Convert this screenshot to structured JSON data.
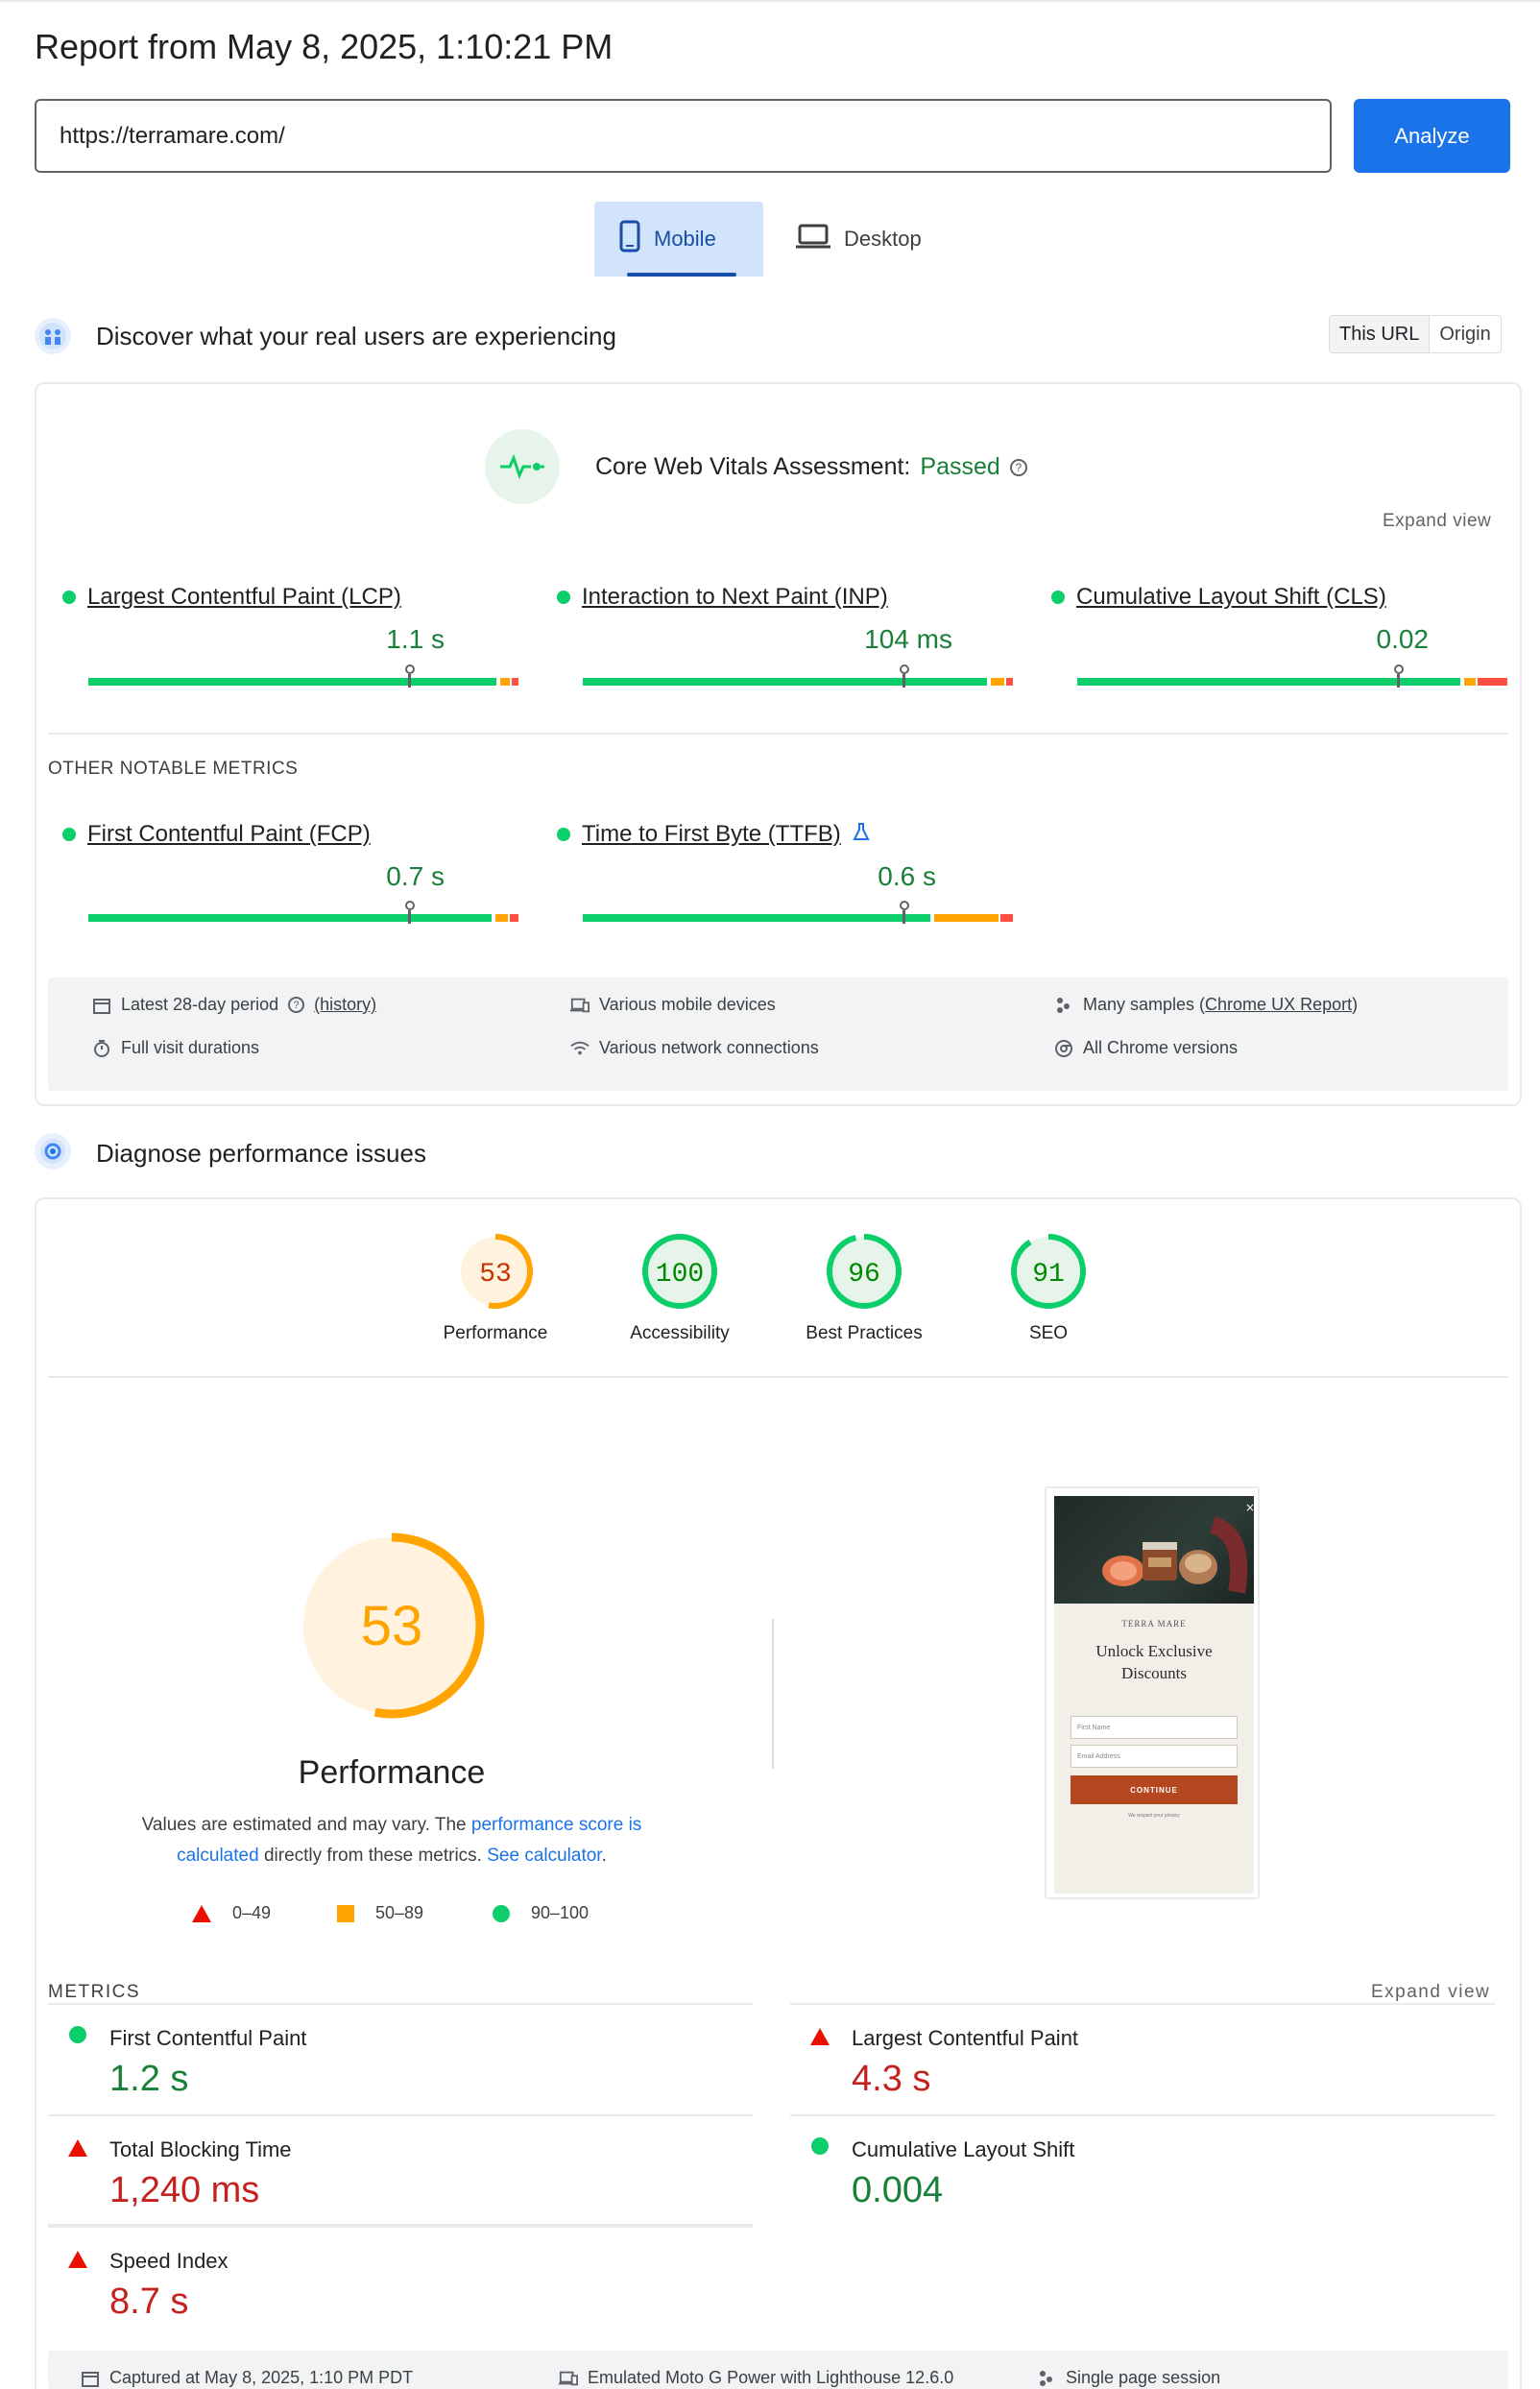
{
  "report": {
    "title": "Report from May 8, 2025, 1:10:21 PM",
    "url_value": "https://terramare.com/",
    "analyze_label": "Analyze"
  },
  "device_tabs": [
    {
      "label": "Mobile",
      "icon": "phone-icon",
      "active": true
    },
    {
      "label": "Desktop",
      "icon": "laptop-icon",
      "active": false
    }
  ],
  "field_section": {
    "title": "Discover what your real users are experiencing",
    "toggle": {
      "this_url": "This URL",
      "origin": "Origin"
    },
    "assessment_prefix": "Core Web Vitals Assessment:",
    "assessment_status": "Passed",
    "expand_label": "Expand view",
    "core_metrics": [
      {
        "name": "Largest Contentful Paint (LCP)",
        "value": "1.1 s",
        "good_fraction": 0.75,
        "marker": 0.75
      },
      {
        "name": "Interaction to Next Paint (INP)",
        "value": "104 ms",
        "good_fraction": 0.75,
        "marker": 0.75
      },
      {
        "name": "Cumulative Layout Shift (CLS)",
        "value": "0.02",
        "good_fraction": 0.75,
        "marker": 0.75
      }
    ],
    "other_label": "OTHER NOTABLE METRICS",
    "other_metrics": [
      {
        "name": "First Contentful Paint (FCP)",
        "value": "0.7 s",
        "marker": 0.75
      },
      {
        "name": "Time to First Byte (TTFB)",
        "value": "0.6 s",
        "marker": 0.75,
        "experimental": true
      }
    ],
    "info": {
      "period": "Latest 28-day period",
      "history": "(history)",
      "devices": "Various mobile devices",
      "samples_prefix": "Many samples (",
      "samples_link": "Chrome UX Report",
      "samples_suffix": ")",
      "durations": "Full visit durations",
      "network": "Various network connections",
      "chrome": "All Chrome versions"
    }
  },
  "diagnose_section": {
    "title": "Diagnose performance issues",
    "scores": [
      {
        "label": "Performance",
        "value": "53",
        "score": 53,
        "color": "#ffa400",
        "bg": "#fff3e0",
        "text_color": "#c33300"
      },
      {
        "label": "Accessibility",
        "value": "100",
        "score": 100,
        "color": "#0cce6b",
        "bg": "#e6f4ea",
        "text_color": "#008800"
      },
      {
        "label": "Best Practices",
        "value": "96",
        "score": 96,
        "color": "#0cce6b",
        "bg": "#e6f4ea",
        "text_color": "#008800"
      },
      {
        "label": "SEO",
        "value": "91",
        "score": 91,
        "color": "#0cce6b",
        "bg": "#e6f4ea",
        "text_color": "#008800"
      }
    ],
    "big_score": {
      "value": "53",
      "score": 53,
      "label": "Performance"
    },
    "note": {
      "part1": "Values are estimated and may vary. The ",
      "link1": "performance score is calculated",
      "part2": " directly from these metrics. ",
      "link2": "See calculator",
      "part3": "."
    },
    "legend": [
      {
        "range": "0–49",
        "shape": "triangle",
        "color": "#eb0f00"
      },
      {
        "range": "50–89",
        "shape": "square",
        "color": "#ffa400"
      },
      {
        "range": "90–100",
        "shape": "circle",
        "color": "#0cce6b"
      }
    ],
    "screenshot": {
      "brand": "TERRA MARE",
      "heading_line1": "Unlock Exclusive",
      "heading_line2": "Discounts",
      "first_name": "First Name",
      "email": "Email Address",
      "cta": "CONTINUE",
      "fine_print": "We respect your privacy"
    },
    "metrics_label": "METRICS",
    "expand_label": "Expand view",
    "lab_metrics": [
      {
        "name": "First Contentful Paint",
        "value": "1.2 s",
        "rating": "good"
      },
      {
        "name": "Largest Contentful Paint",
        "value": "4.3 s",
        "rating": "poor"
      },
      {
        "name": "Total Blocking Time",
        "value": "1,240 ms",
        "rating": "poor"
      },
      {
        "name": "Cumulative Layout Shift",
        "value": "0.004",
        "rating": "good"
      },
      {
        "name": "Speed Index",
        "value": "8.7 s",
        "rating": "poor"
      }
    ],
    "footer": {
      "captured": "Captured at May 8, 2025, 1:10 PM PDT",
      "emulated": "Emulated Moto G Power with Lighthouse 12.6.0",
      "session": "Single page session"
    }
  }
}
